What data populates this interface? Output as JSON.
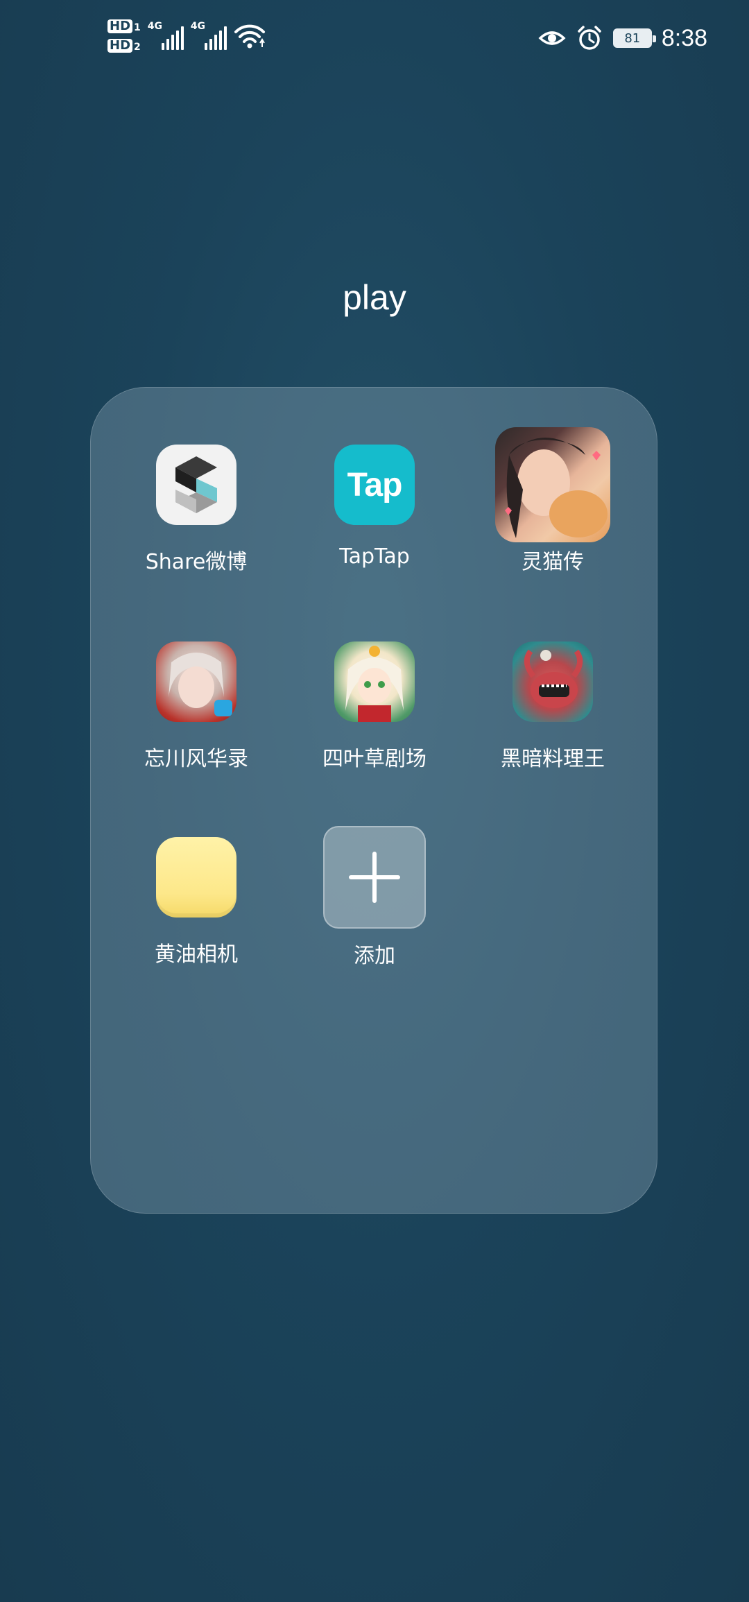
{
  "status_bar": {
    "sim1_badge": "HD",
    "sim1_num": "1",
    "sim2_badge": "HD",
    "sim2_num": "2",
    "net1": "4G",
    "net2": "4G",
    "battery": "81",
    "time": "8:38",
    "icons": [
      "eye-icon",
      "alarm-icon",
      "wifi-icon",
      "signal-icon"
    ]
  },
  "folder": {
    "title": "play",
    "apps": [
      {
        "label": "Share微博",
        "icon": "share-weibo-icon"
      },
      {
        "label": "TapTap",
        "icon": "taptap-icon",
        "icon_text": "Tap"
      },
      {
        "label": "灵猫传",
        "icon": "lingmaozhuan-icon"
      },
      {
        "label": "忘川风华录",
        "icon": "wangchuan-icon"
      },
      {
        "label": "四叶草剧场",
        "icon": "siyecao-icon"
      },
      {
        "label": "黑暗料理王",
        "icon": "heian-liaoliwang-icon"
      },
      {
        "label": "黄油相机",
        "icon": "huangyou-camera-icon"
      }
    ],
    "add_label": "添加"
  },
  "colors": {
    "background": "#1b435a",
    "taptap": "#15bccc",
    "butter": "#fde88a"
  }
}
